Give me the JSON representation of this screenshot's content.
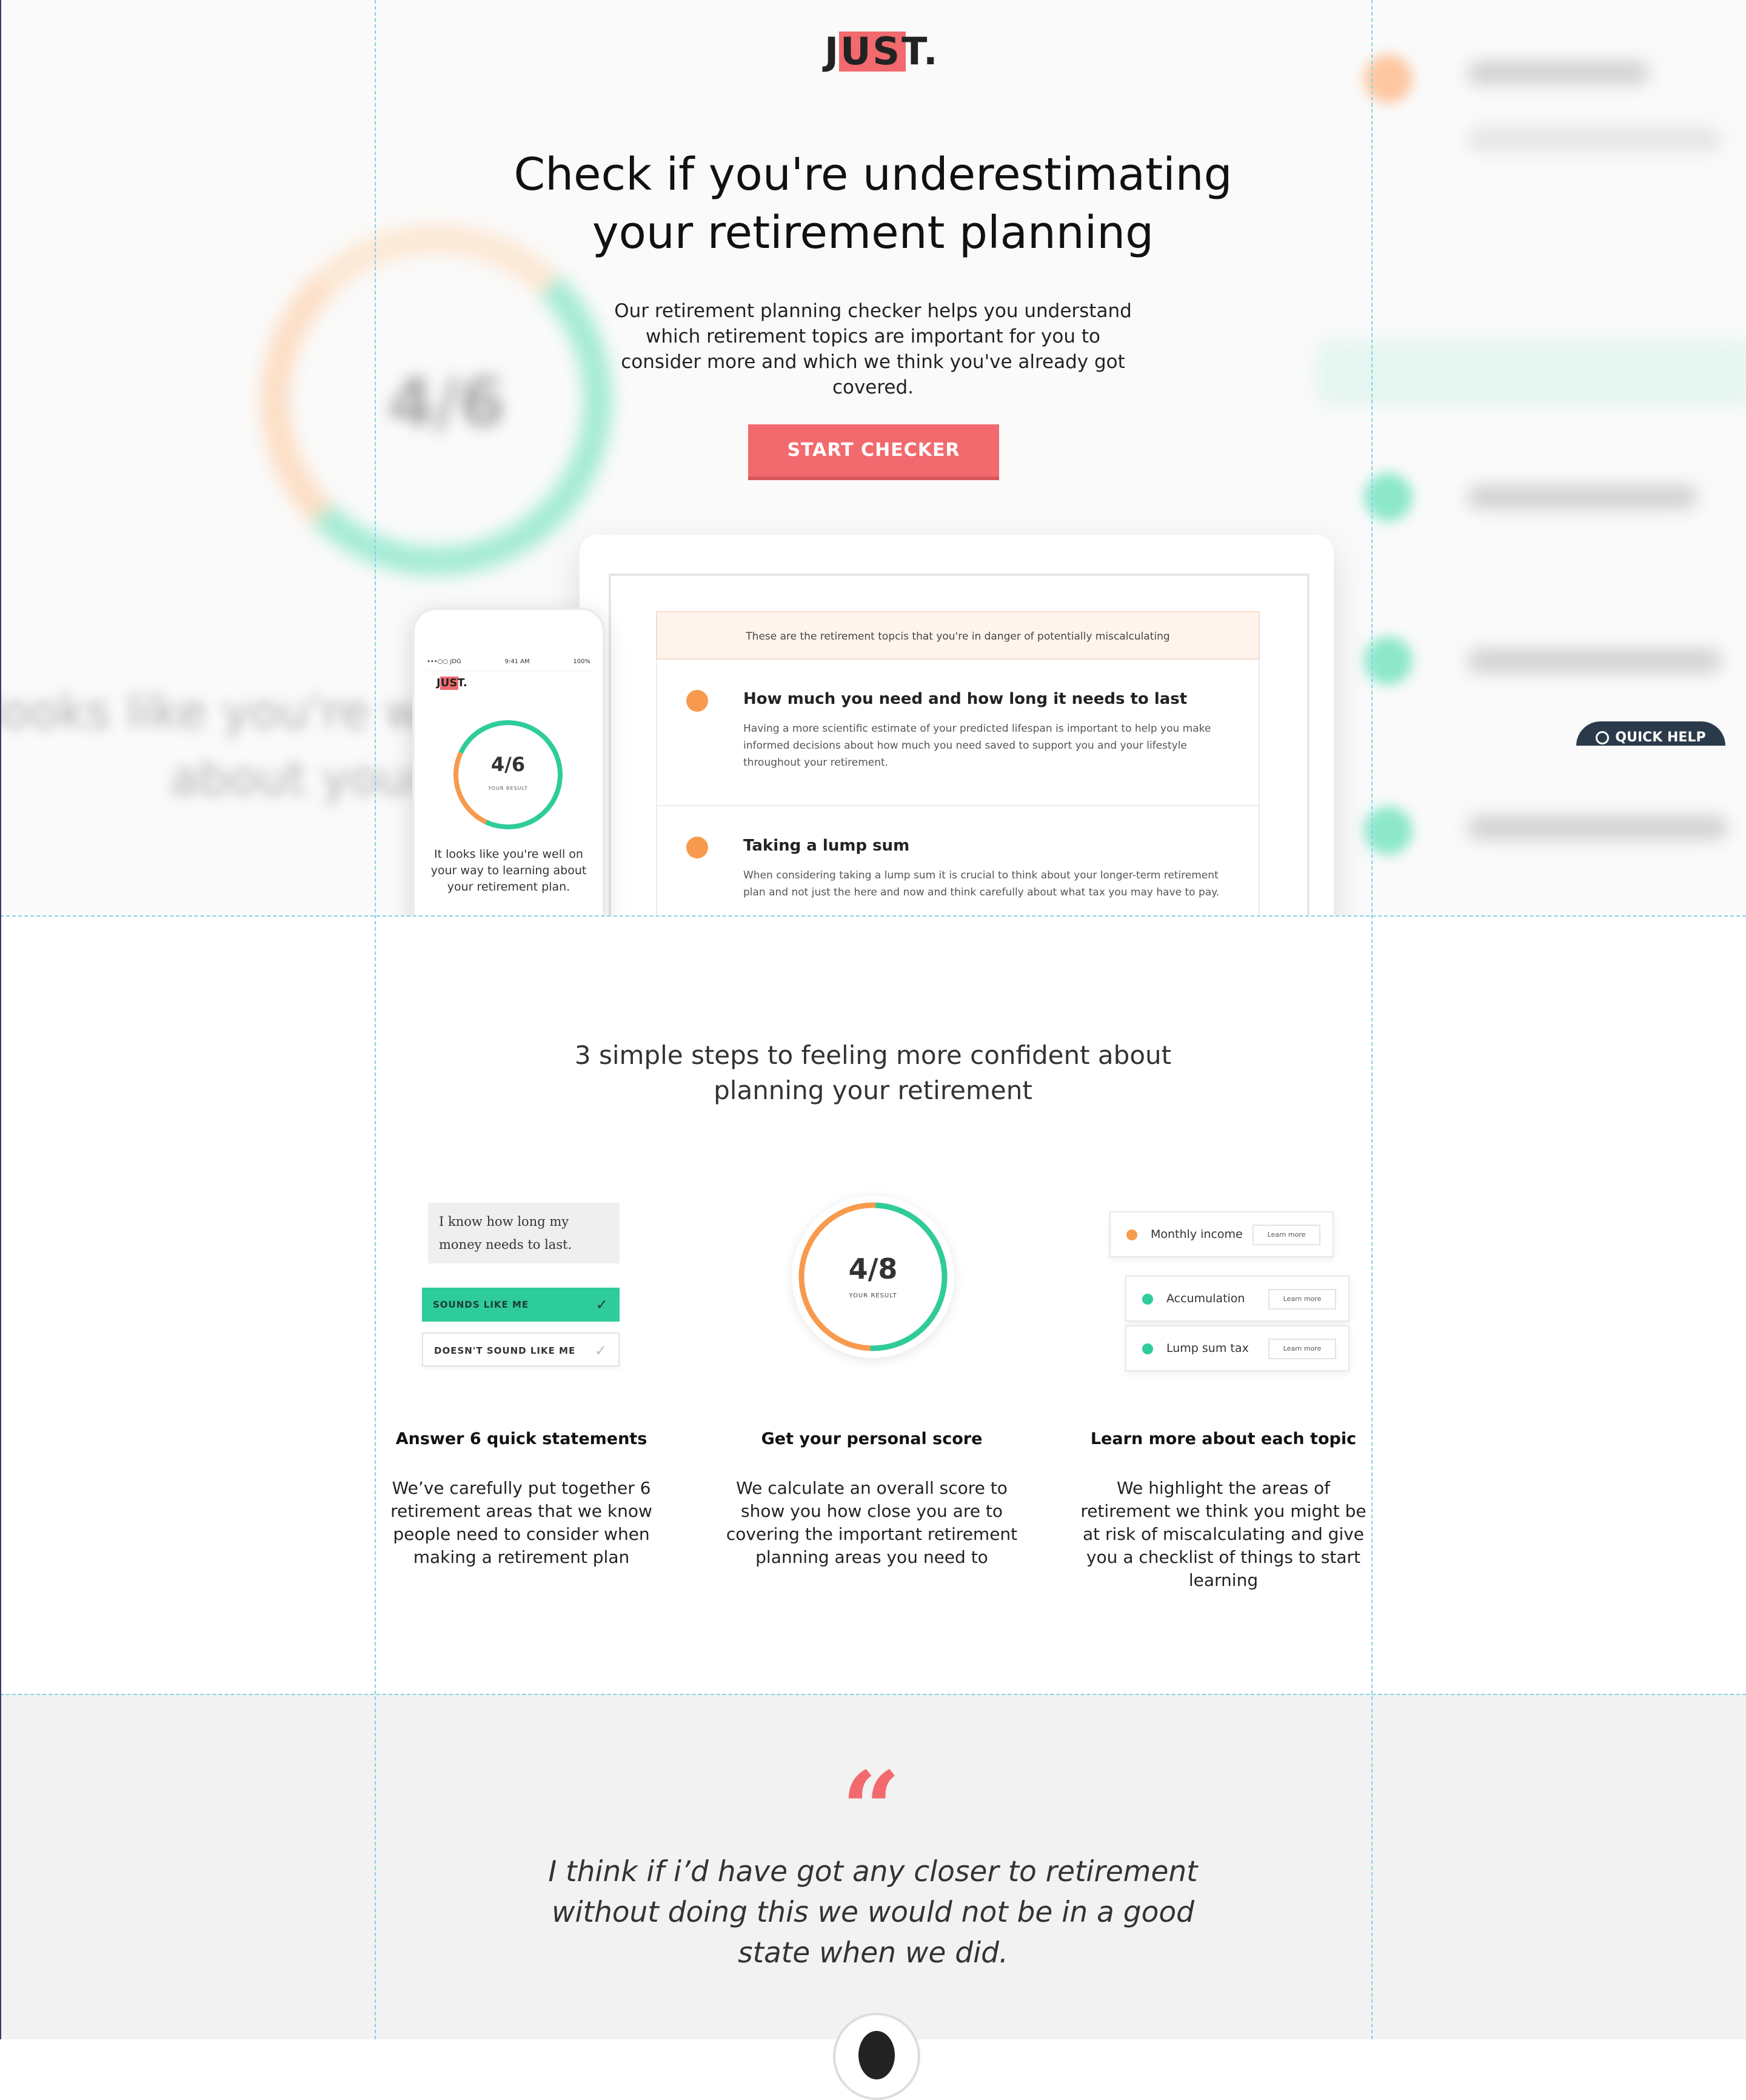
{
  "brand": {
    "logo_text": "JUST.",
    "accent_color": "#f26a6e"
  },
  "hero": {
    "title": "Check if you're underestimating your retirement planning",
    "subtitle": "Our retirement planning checker helps you understand which retirement topics are important for you to consider more and which we think you've already got covered.",
    "cta_label": "START CHECKER"
  },
  "laptop_screen": {
    "banner": "These are the retirement topcis that you're in danger of potentially miscalculating",
    "topics": [
      {
        "title": "How much you need and how long it needs to last",
        "description": "Having a more scientific estimate of your predicted lifespan is important to help you make informed decisions about how much you need saved to support you and your lifestyle throughout your retirement."
      },
      {
        "title": "Taking a lump sum",
        "description": "When considering taking a lump sum it is crucial to think about your longer-term retirement plan and not just the here and now and think carefully about what tax you may have to pay."
      }
    ]
  },
  "phone": {
    "carrier": "•••○○ JDG",
    "time": "9:41 AM",
    "battery": "100%",
    "logo": "JUST.",
    "score": "4/6",
    "score_label": "YOUR RESULT",
    "text": "It looks like you're well on your way to learning about your retirement plan."
  },
  "quick_help": {
    "label": "QUICK HELP"
  },
  "steps": {
    "title": "3 simple steps to feeling more confident about planning your retirement",
    "statement_bubble": "I know how long my money needs to last.",
    "option_yes": "SOUNDS LIKE ME",
    "option_no": "DOESN'T SOUND LIKE ME",
    "score": "4/8",
    "score_label": "YOUR RESULT",
    "score_fraction": 0.5,
    "topic_pills": [
      {
        "label": "Monthly income",
        "button": "Learn more",
        "color": "#f79a4d"
      },
      {
        "label": "Accumulation",
        "button": "Learn more",
        "color": "#2ecc9a"
      },
      {
        "label": "Lump sum tax",
        "button": "Learn more",
        "color": "#2ecc9a"
      }
    ],
    "columns": [
      {
        "heading": "Answer 6 quick statements",
        "text": "We’ve carefully put together 6 retirement areas that we know people need to consider when making a retirement plan"
      },
      {
        "heading": "Get your personal score",
        "text": "We calculate an overall score to show you how close you are to covering the important retirement planning areas you need to"
      },
      {
        "heading": "Learn more about each topic",
        "text": "We highlight the areas of retirement we think you might be at risk of miscalculating and give you a checklist of things to start learning"
      }
    ]
  },
  "testimonial": {
    "quote": "I think if i’d have got any closer to retirement without doing this we would not be in a good state when we did."
  }
}
